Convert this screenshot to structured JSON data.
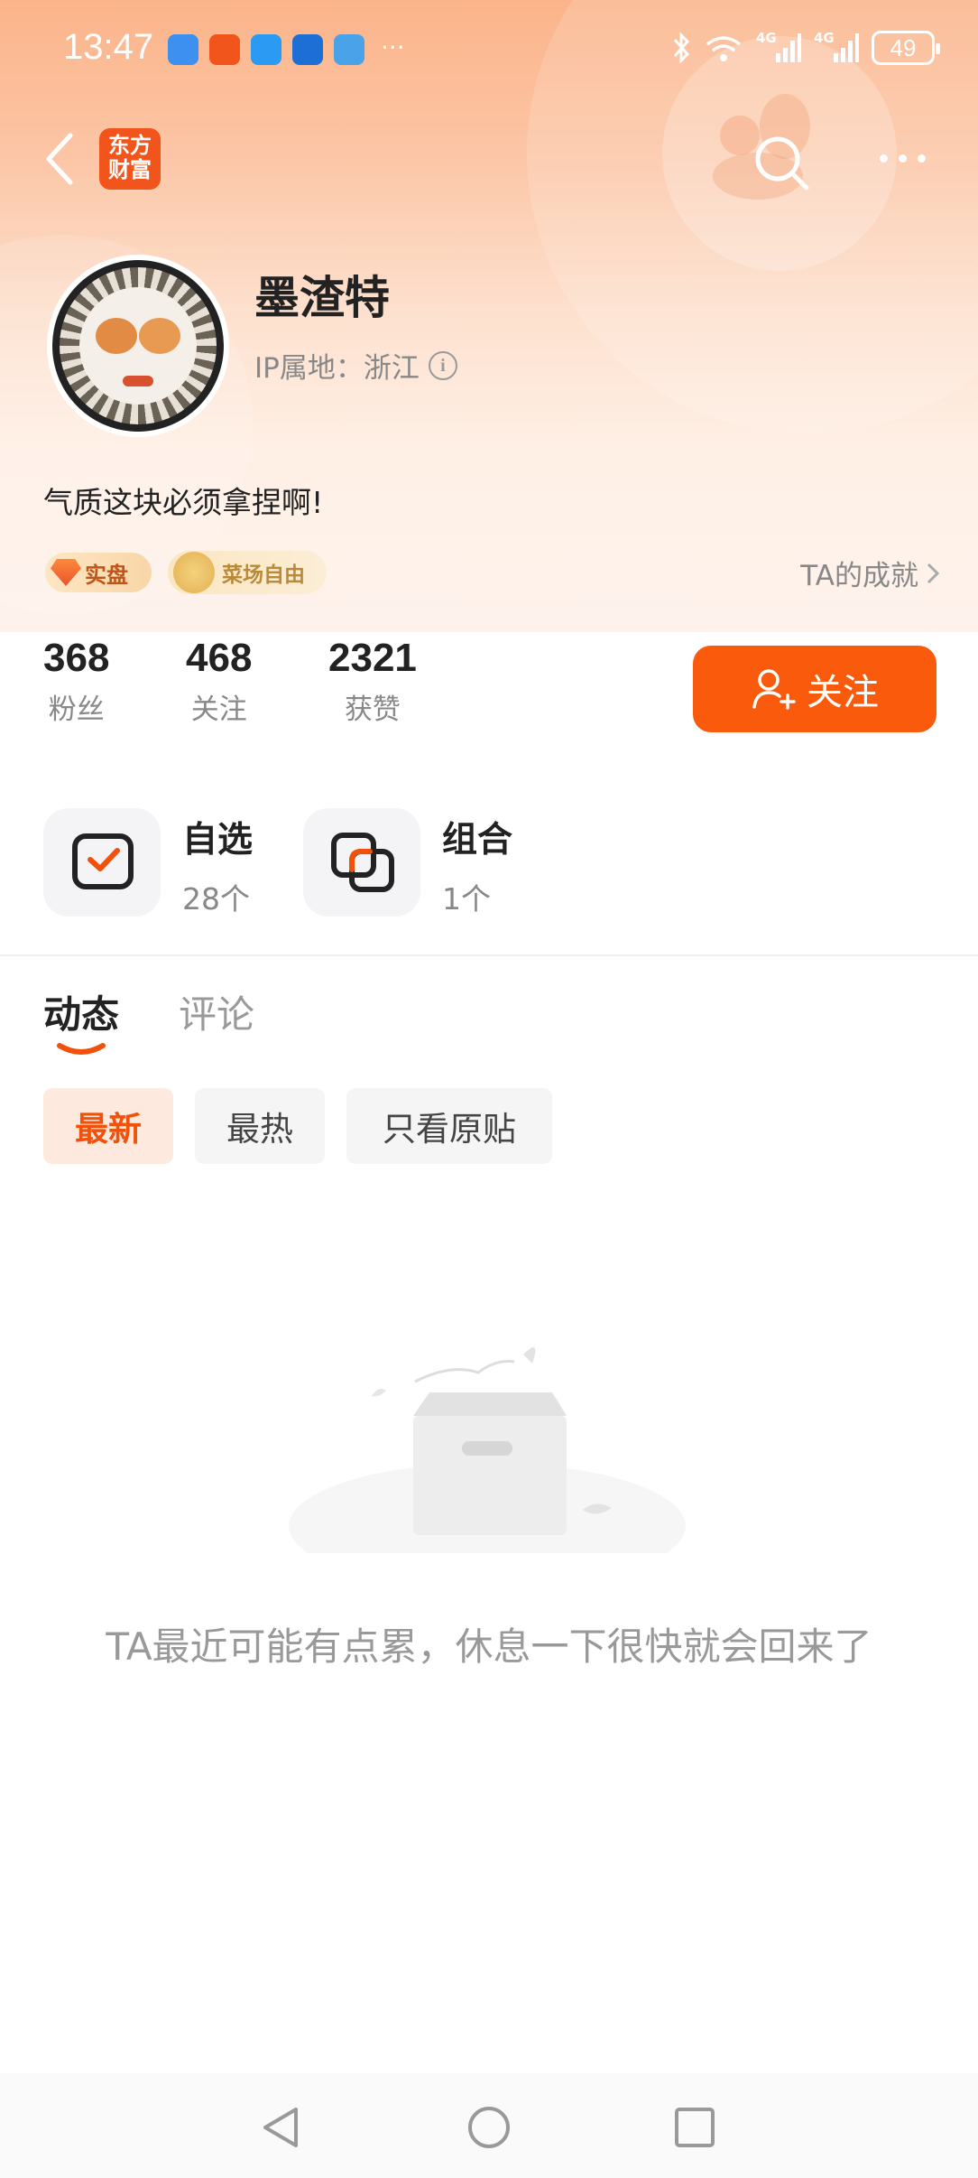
{
  "status_bar": {
    "time": "13:47",
    "notification_more": "···",
    "battery": "49",
    "signal_labels": [
      "4G",
      "4G"
    ]
  },
  "header": {
    "logo_line1": "东方",
    "logo_line2": "财富"
  },
  "profile": {
    "username": "墨渣特",
    "ip_location": "IP属地：浙江",
    "bio": "气质这块必须拿捏啊!",
    "badges": [
      {
        "label": "实盘"
      },
      {
        "label": "菜场自由"
      }
    ],
    "achievement_label": "TA的成就"
  },
  "stats": [
    {
      "value": "368",
      "label": "粉丝"
    },
    {
      "value": "468",
      "label": "关注"
    },
    {
      "value": "2321",
      "label": "获赞"
    }
  ],
  "follow_button_label": "关注",
  "shortcuts": [
    {
      "title": "自选",
      "count": "28个"
    },
    {
      "title": "组合",
      "count": "1个"
    }
  ],
  "tabs": [
    {
      "label": "动态",
      "active": true
    },
    {
      "label": "评论",
      "active": false
    }
  ],
  "filters": [
    {
      "label": "最新",
      "active": true
    },
    {
      "label": "最热",
      "active": false
    },
    {
      "label": "只看原贴",
      "active": false
    }
  ],
  "empty_state_text": "TA最近可能有点累，休息一下很快就会回来了",
  "colors": {
    "accent": "#fa5a0c",
    "header_gradient_top": "#fbb48a",
    "muted_text": "#888888"
  },
  "icons": {
    "back": "chevron-left-icon",
    "search": "search-icon",
    "more": "more-horizontal-icon",
    "info": "info-icon",
    "follow": "add-user-icon",
    "watchlist": "checkbox-icon",
    "portfolio": "portfolio-icon",
    "empty": "empty-box-icon"
  }
}
